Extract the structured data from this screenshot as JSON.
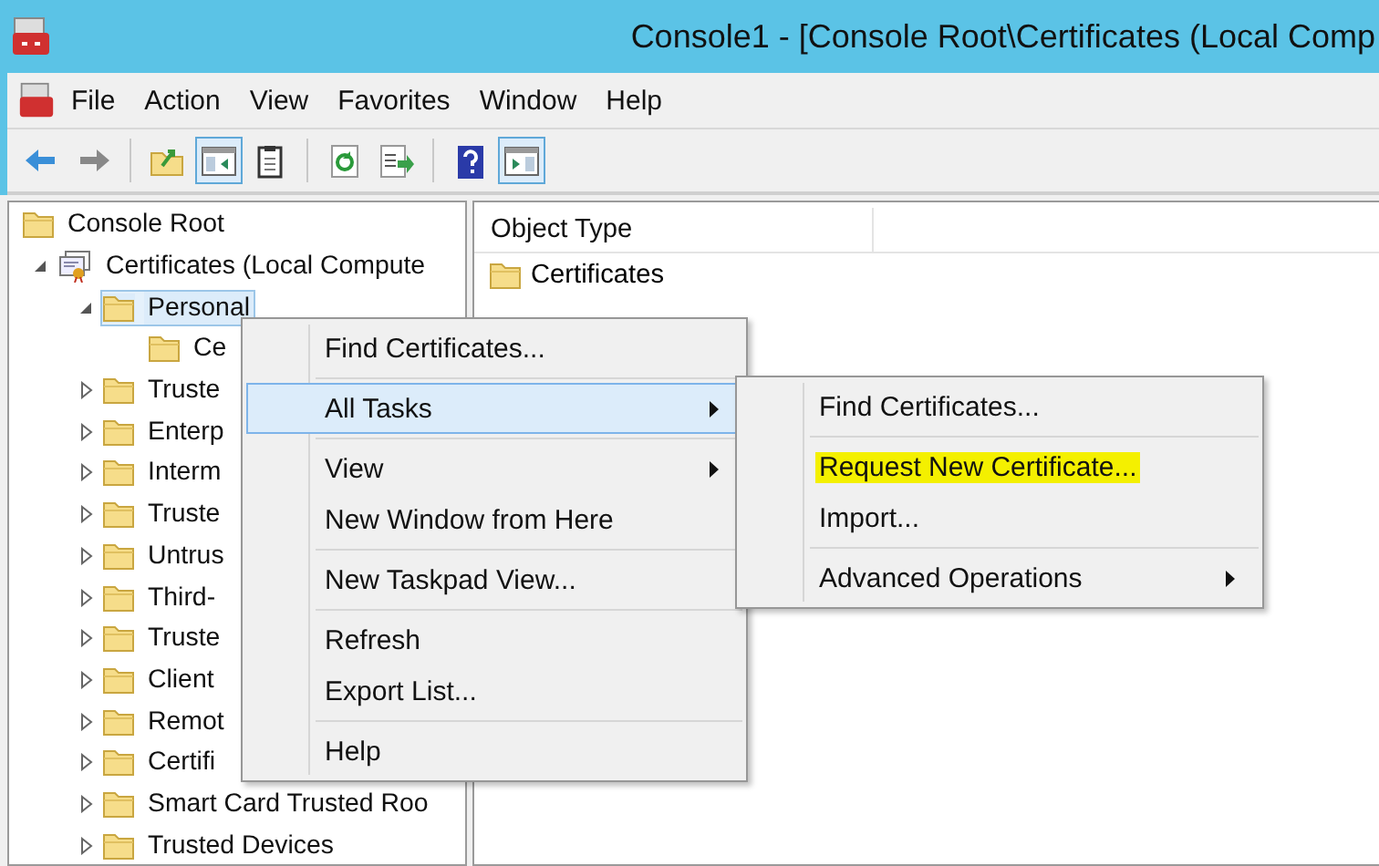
{
  "window": {
    "title": "Console1 - [Console Root\\Certificates (Local Comp"
  },
  "menu_bar": [
    "File",
    "Action",
    "View",
    "Favorites",
    "Window",
    "Help"
  ],
  "toolbar": {
    "groups": [
      [
        {
          "pressed": false
        },
        {
          "pressed": false
        }
      ],
      [
        {
          "pressed": false
        },
        {
          "pressed": true
        },
        {
          "pressed": false
        }
      ],
      [
        {
          "pressed": false
        },
        {
          "pressed": false
        }
      ],
      [
        {
          "pressed": false
        },
        {
          "pressed": true
        }
      ]
    ]
  },
  "tree": [
    {
      "label": "Console Root",
      "kind": "folder",
      "selected": false,
      "children": [
        {
          "label": "Certificates (Local Compute",
          "kind": "store",
          "expanded": true,
          "selected": false,
          "children": [
            {
              "label": "Personal",
              "kind": "folder",
              "expanded": true,
              "selected": true,
              "children": [
                {
                  "label": "Ce",
                  "kind": "folder",
                  "selected": false
                }
              ]
            },
            {
              "label": "Truste",
              "kind": "folder",
              "expanded": false,
              "selected": false
            },
            {
              "label": "Enterp",
              "kind": "folder",
              "expanded": false,
              "selected": false
            },
            {
              "label": "Interm",
              "kind": "folder",
              "expanded": false,
              "selected": false
            },
            {
              "label": "Truste",
              "kind": "folder",
              "expanded": false,
              "selected": false
            },
            {
              "label": "Untrus",
              "kind": "folder",
              "expanded": false,
              "selected": false
            },
            {
              "label": "Third-",
              "kind": "folder",
              "expanded": false,
              "selected": false
            },
            {
              "label": "Truste",
              "kind": "folder",
              "expanded": false,
              "selected": false
            },
            {
              "label": "Client",
              "kind": "folder",
              "expanded": false,
              "selected": false
            },
            {
              "label": "Remot",
              "kind": "folder",
              "expanded": false,
              "selected": false
            },
            {
              "label": "Certifi",
              "kind": "folder",
              "expanded": false,
              "selected": false
            },
            {
              "label": "Smart Card Trusted Roo",
              "kind": "folder",
              "expanded": false,
              "selected": false
            },
            {
              "label": "Trusted Devices",
              "kind": "folder",
              "expanded": false,
              "selected": false
            }
          ]
        }
      ]
    }
  ],
  "list": {
    "columns": [
      "Object Type"
    ],
    "rows": [
      "Certificates"
    ]
  },
  "context_menu": [
    {
      "items": [
        {
          "label": "Find Certificates...",
          "submenu": false,
          "selected": false
        },
        {
          "kind": "separator"
        },
        {
          "label": "All Tasks",
          "submenu": true,
          "selected": true
        },
        {
          "kind": "separator"
        },
        {
          "label": "View",
          "submenu": true,
          "selected": false
        },
        {
          "label": "New Window from Here",
          "submenu": false,
          "selected": false
        },
        {
          "kind": "separator"
        },
        {
          "label": "New Taskpad View...",
          "submenu": false,
          "selected": false
        },
        {
          "kind": "separator"
        },
        {
          "label": "Refresh",
          "submenu": false,
          "selected": false
        },
        {
          "label": "Export List...",
          "submenu": false,
          "selected": false
        },
        {
          "kind": "separator"
        },
        {
          "label": "Help",
          "submenu": false,
          "selected": false
        }
      ]
    },
    {
      "items": [
        {
          "label": "Find Certificates...",
          "submenu": false,
          "selected": false
        },
        {
          "kind": "separator"
        },
        {
          "label": "Request New Certificate...",
          "submenu": false,
          "selected": false,
          "highlighted": true
        },
        {
          "label": "Import...",
          "submenu": false,
          "selected": false
        },
        {
          "kind": "separator"
        },
        {
          "label": "Advanced Operations",
          "submenu": true,
          "selected": false
        }
      ]
    }
  ]
}
